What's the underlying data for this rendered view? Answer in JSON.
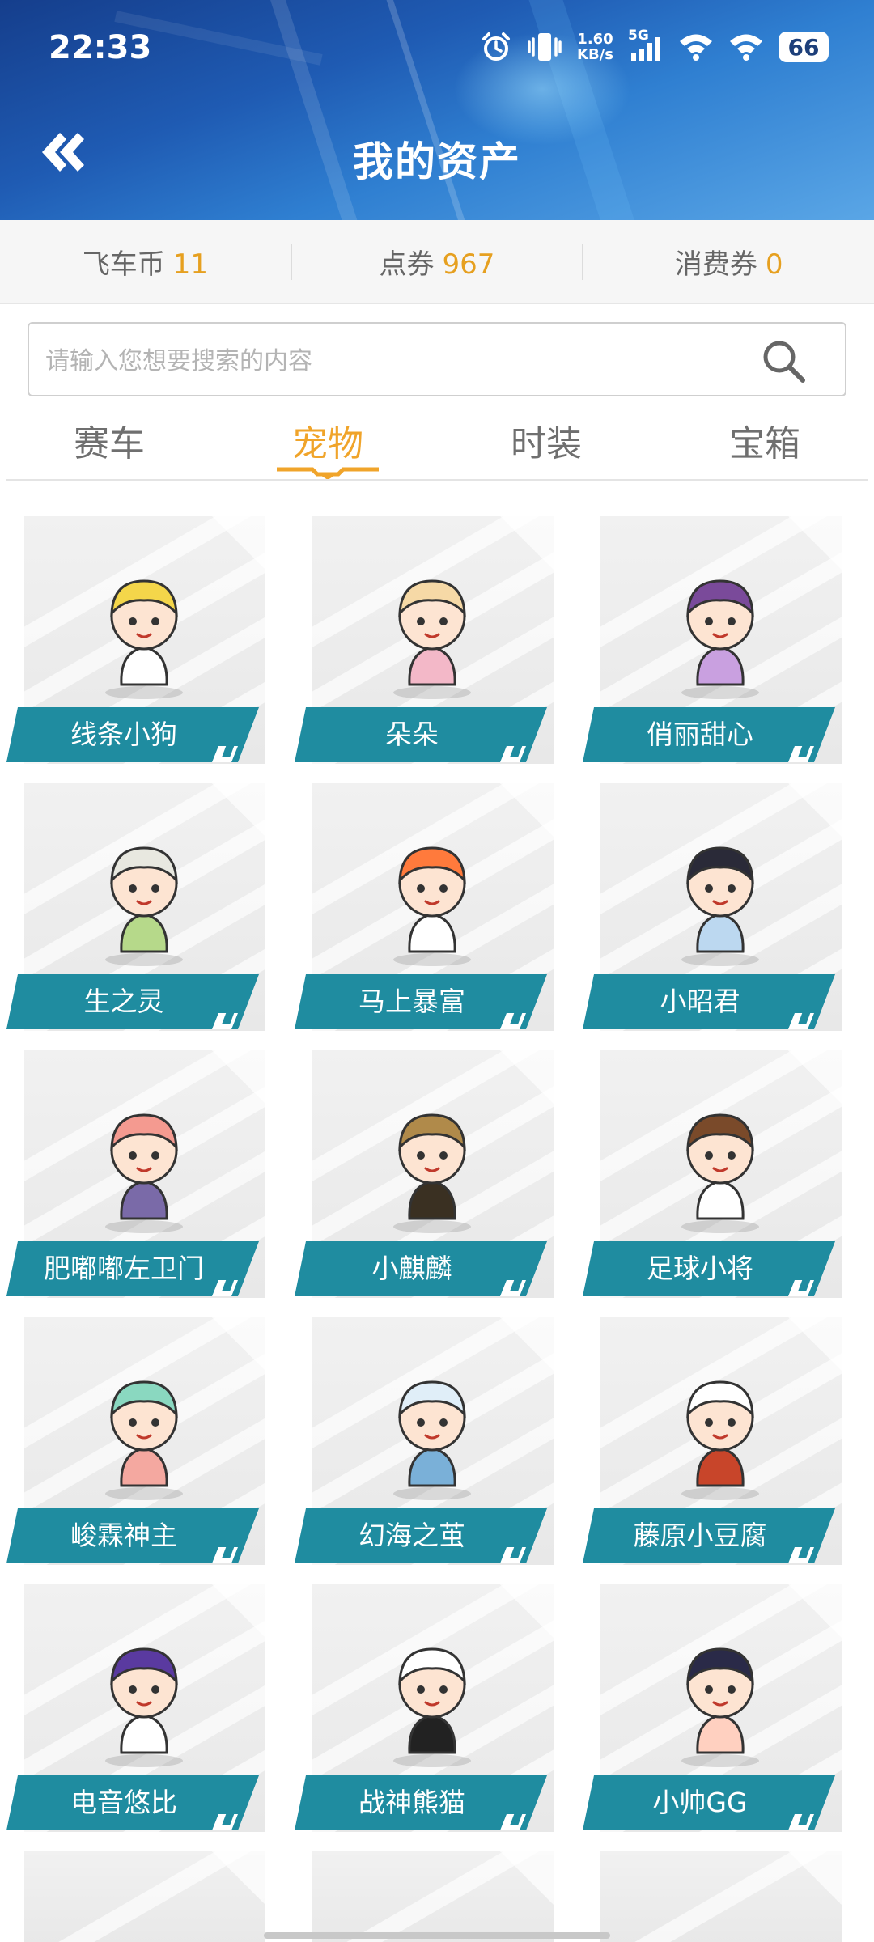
{
  "status_bar": {
    "time": "22:33",
    "speed_value": "1.60",
    "speed_unit": "KB/s",
    "network": "5G",
    "battery": "66",
    "icons": [
      "alarm-icon",
      "vibrate-icon",
      "signal-icon",
      "wifi-icon",
      "wifi-icon",
      "battery-icon"
    ]
  },
  "header": {
    "title": "我的资产",
    "back_icon": "double-chevron-left-icon"
  },
  "currencies": [
    {
      "label": "飞车币",
      "value": "11"
    },
    {
      "label": "点券",
      "value": "967"
    },
    {
      "label": "消费券",
      "value": "0"
    }
  ],
  "search": {
    "placeholder": "请输入您想要搜索的内容",
    "icon": "search-icon"
  },
  "tabs": [
    {
      "label": "赛车",
      "active": false
    },
    {
      "label": "宠物",
      "active": true
    },
    {
      "label": "时装",
      "active": false
    },
    {
      "label": "宝箱",
      "active": false
    }
  ],
  "pets": [
    {
      "name": "线条小狗"
    },
    {
      "name": "朵朵"
    },
    {
      "name": "俏丽甜心"
    },
    {
      "name": "生之灵"
    },
    {
      "name": "马上暴富"
    },
    {
      "name": "小昭君"
    },
    {
      "name": "肥嘟嘟左卫门"
    },
    {
      "name": "小麒麟"
    },
    {
      "name": "足球小将"
    },
    {
      "name": "峻霖神主"
    },
    {
      "name": "幻海之茧"
    },
    {
      "name": "藤原小豆腐"
    },
    {
      "name": "电音悠比"
    },
    {
      "name": "战神熊猫"
    },
    {
      "name": "小帅GG"
    }
  ],
  "colors": {
    "accent": "#f0a42a",
    "ribbon": "#1f8ca0",
    "header_blue": "#1f5bb3"
  }
}
